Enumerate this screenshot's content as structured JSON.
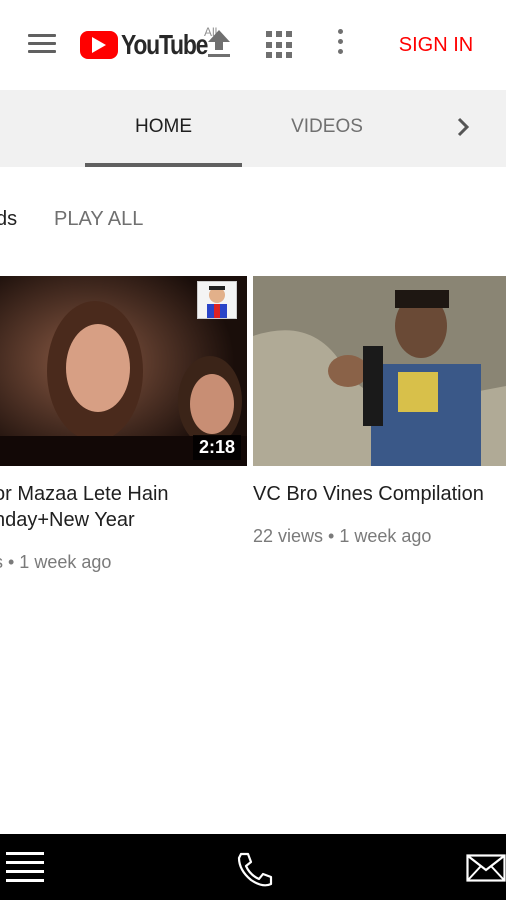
{
  "header": {
    "logo_text": "YouTube",
    "logo_superscript": "All",
    "sign_in": "SIGN IN",
    "brand_color": "#ff0000",
    "icons": [
      "menu-icon",
      "youtube-play-icon",
      "upload-icon",
      "apps-grid-icon",
      "more-vert-icon"
    ]
  },
  "tabs": [
    {
      "label": "HOME",
      "active": true
    },
    {
      "label": "VIDEOS",
      "active": false
    }
  ],
  "section": {
    "title": "ds",
    "play_all": "PLAY ALL"
  },
  "videos": [
    {
      "title_line1": "or Mazaa Lete Hain",
      "title_line2": "nday+New Year",
      "meta": "s • 1 week ago",
      "duration": "2:18"
    },
    {
      "title_line1": "VC Bro Vines Compilation",
      "meta": "22 views • 1 week ago"
    }
  ],
  "bottom_bar": {
    "icons": [
      "hamburger-icon",
      "phone-icon",
      "mail-icon"
    ]
  }
}
